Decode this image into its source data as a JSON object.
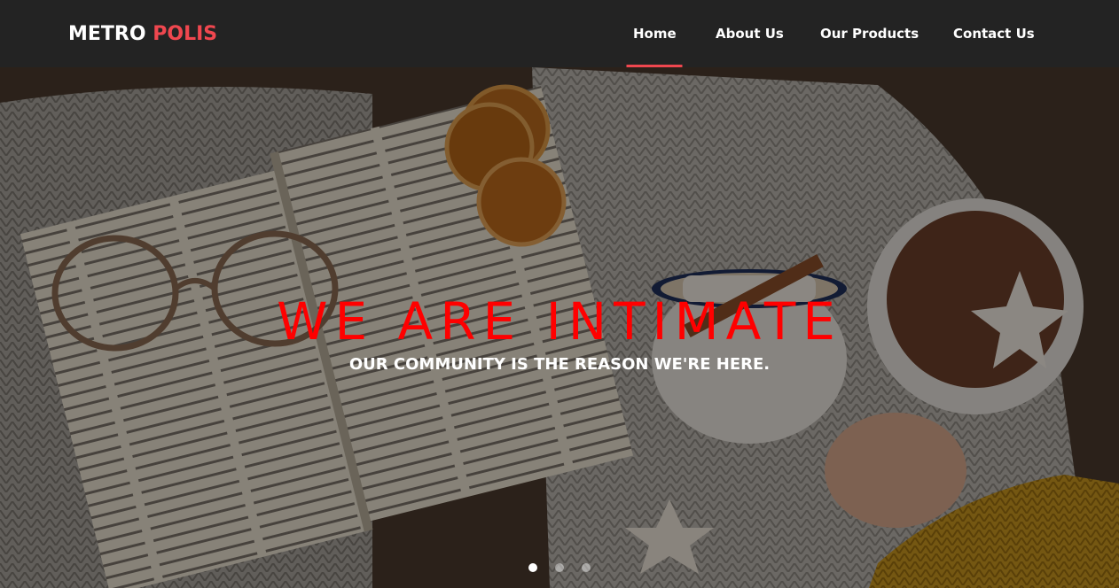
{
  "brand": {
    "part1": "METRO",
    "part2": "POLIS"
  },
  "nav": {
    "items": [
      {
        "label": "Home",
        "active": true
      },
      {
        "label": "About Us"
      },
      {
        "label": "Our Products"
      },
      {
        "label": "Contact Us"
      }
    ]
  },
  "hero": {
    "title": "WE ARE INTIMATE",
    "subtitle": "OUR COMMUNITY IS THE REASON WE'RE HERE.",
    "slide_count": 3,
    "active_slide": 1
  },
  "colors": {
    "navbar": "#232323",
    "accent": "#f0474f",
    "title": "#ff0000"
  }
}
